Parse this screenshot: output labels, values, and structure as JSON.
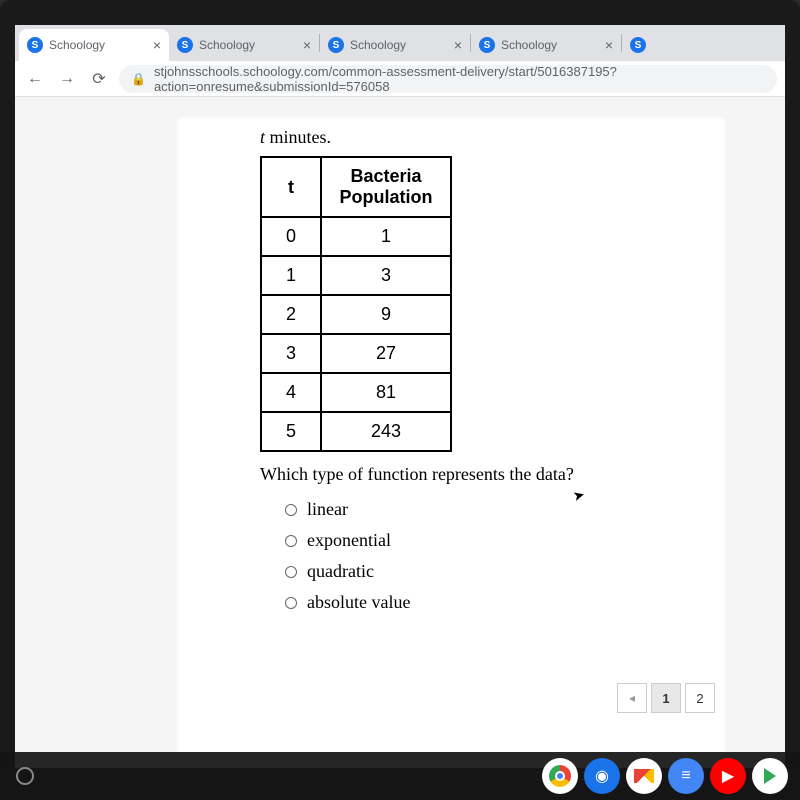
{
  "browser": {
    "tabs": [
      {
        "title": "Schoology",
        "active": true
      },
      {
        "title": "Schoology",
        "active": false
      },
      {
        "title": "Schoology",
        "active": false
      },
      {
        "title": "Schoology",
        "active": false
      }
    ],
    "url": "stjohnsschools.schoology.com/common-assessment-delivery/start/5016387195?action=onresume&submissionId=576058"
  },
  "question": {
    "heading_prefix_var": "t",
    "heading_suffix": " minutes.",
    "table": {
      "headers": [
        "t",
        "Bacteria Population"
      ],
      "rows": [
        [
          "0",
          "1"
        ],
        [
          "1",
          "3"
        ],
        [
          "2",
          "9"
        ],
        [
          "3",
          "27"
        ],
        [
          "4",
          "81"
        ],
        [
          "5",
          "243"
        ]
      ]
    },
    "prompt": "Which type of function represents the data?",
    "options": [
      "linear",
      "exponential",
      "quadratic",
      "absolute value"
    ]
  },
  "pager": {
    "prev": "◂",
    "pages": [
      "1",
      "2"
    ],
    "active": "1"
  },
  "chart_data": {
    "type": "table",
    "title": "Bacteria Population vs t (minutes)",
    "columns": [
      "t",
      "Bacteria Population"
    ],
    "rows": [
      [
        0,
        1
      ],
      [
        1,
        3
      ],
      [
        2,
        9
      ],
      [
        3,
        27
      ],
      [
        4,
        81
      ],
      [
        5,
        243
      ]
    ]
  }
}
